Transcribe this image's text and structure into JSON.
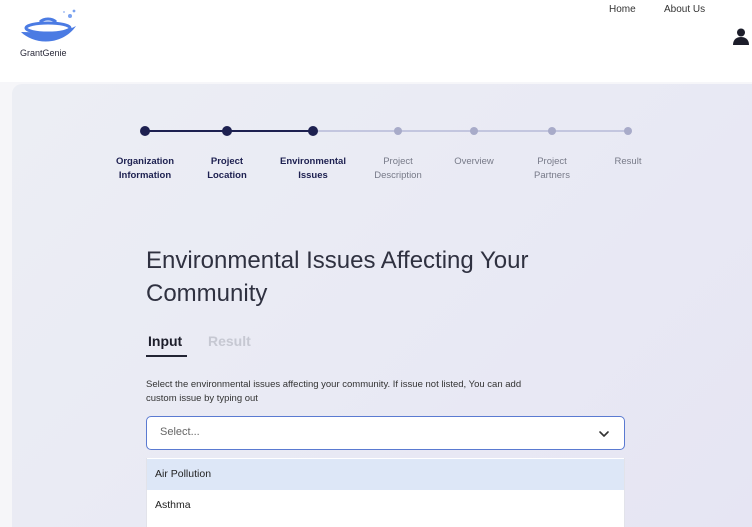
{
  "app": {
    "name": "GrantGenie",
    "logo_icon": "genie-lamp-icon"
  },
  "nav": {
    "home": "Home",
    "about": "About Us",
    "user_icon": "user-icon"
  },
  "stepper": {
    "current_step": 3,
    "steps": [
      {
        "label_line1": "Organization",
        "label_line2": "Information",
        "state": "done"
      },
      {
        "label_line1": "Project",
        "label_line2": "Location",
        "state": "done"
      },
      {
        "label_line1": "Environmental",
        "label_line2": "Issues",
        "state": "current"
      },
      {
        "label_line1": "Project",
        "label_line2": "Description",
        "state": "todo"
      },
      {
        "label_line1": "Overview",
        "label_line2": "",
        "state": "todo"
      },
      {
        "label_line1": "Project",
        "label_line2": "Partners",
        "state": "todo"
      },
      {
        "label_line1": "Result",
        "label_line2": "",
        "state": "todo"
      }
    ]
  },
  "main": {
    "title_line1": "Environmental Issues Affecting Your",
    "title_line2": "Community",
    "tabs": [
      {
        "label": "Input",
        "active": true
      },
      {
        "label": "Result",
        "active": false
      }
    ],
    "description_line1": "Select the environmental issues affecting your community. If issue not listed, You can add",
    "description_line2": "custom issue by typing out",
    "select": {
      "placeholder": "Select...",
      "caret_icon": "chevron-down-icon",
      "open": true,
      "options": [
        {
          "label": "Air Pollution",
          "highlighted": true
        },
        {
          "label": "Asthma",
          "highlighted": false
        }
      ]
    }
  },
  "colors": {
    "step_done": "#1d2050",
    "step_todo": "#a8abc9",
    "line_todo": "#c3c6df",
    "accent_border": "#5a7ad1",
    "option_highlight": "#dde7f7",
    "logo": "#4b7be3"
  }
}
